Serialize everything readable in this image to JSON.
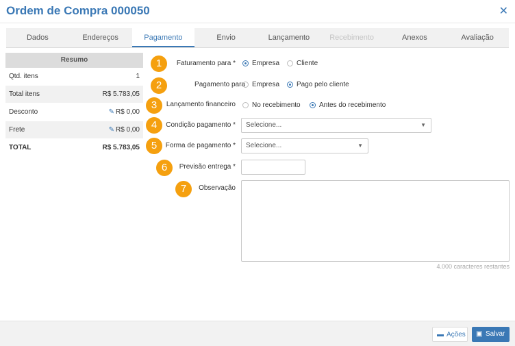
{
  "header": {
    "title": "Ordem de Compra 000050",
    "close_icon": "close-icon"
  },
  "tabs": [
    {
      "label": "Dados",
      "active": false,
      "disabled": false
    },
    {
      "label": "Endereços",
      "active": false,
      "disabled": false
    },
    {
      "label": "Pagamento",
      "active": true,
      "disabled": false
    },
    {
      "label": "Envio",
      "active": false,
      "disabled": false
    },
    {
      "label": "Lançamento",
      "active": false,
      "disabled": false
    },
    {
      "label": "Recebimento",
      "active": false,
      "disabled": true
    },
    {
      "label": "Anexos",
      "active": false,
      "disabled": false
    },
    {
      "label": "Avaliação",
      "active": false,
      "disabled": false
    }
  ],
  "summary": {
    "title": "Resumo",
    "rows": [
      {
        "label": "Qtd. itens",
        "value": "1"
      },
      {
        "label": "Total itens",
        "value": "R$ 5.783,05"
      },
      {
        "label": "Desconto",
        "value": "R$ 0,00"
      },
      {
        "label": "Frete",
        "value": "R$ 0,00"
      },
      {
        "label": "TOTAL",
        "value": "R$ 5.783,05"
      }
    ]
  },
  "form": {
    "faturamento": {
      "badge": "1",
      "label": "Faturamento para *",
      "opt1": "Empresa",
      "opt2": "Cliente",
      "selected": "Empresa"
    },
    "pagamento": {
      "badge": "2",
      "label": "Pagamento para",
      "opt1": "Empresa",
      "opt2": "Pago pelo cliente",
      "selected": "Pago pelo cliente"
    },
    "lancamento": {
      "badge": "3",
      "label": "Lançamento financeiro",
      "opt1": "No recebimento",
      "opt2": "Antes do recebimento",
      "selected": "Antes do recebimento"
    },
    "condicao": {
      "badge": "4",
      "label": "Condição pagamento *",
      "value": "Selecione..."
    },
    "forma": {
      "badge": "5",
      "label": "Forma de pagamento *",
      "value": "Selecione..."
    },
    "previsao": {
      "badge": "6",
      "label": "Previsão entrega *",
      "value": ""
    },
    "observacao": {
      "badge": "7",
      "label": "Observação",
      "value": "",
      "counter": "4.000  caracteres restantes"
    }
  },
  "footer": {
    "acoes_label": "Ações",
    "salvar_label": "Salvar"
  },
  "colors": {
    "accent": "#3a78b5",
    "badge": "#f5a00f"
  }
}
